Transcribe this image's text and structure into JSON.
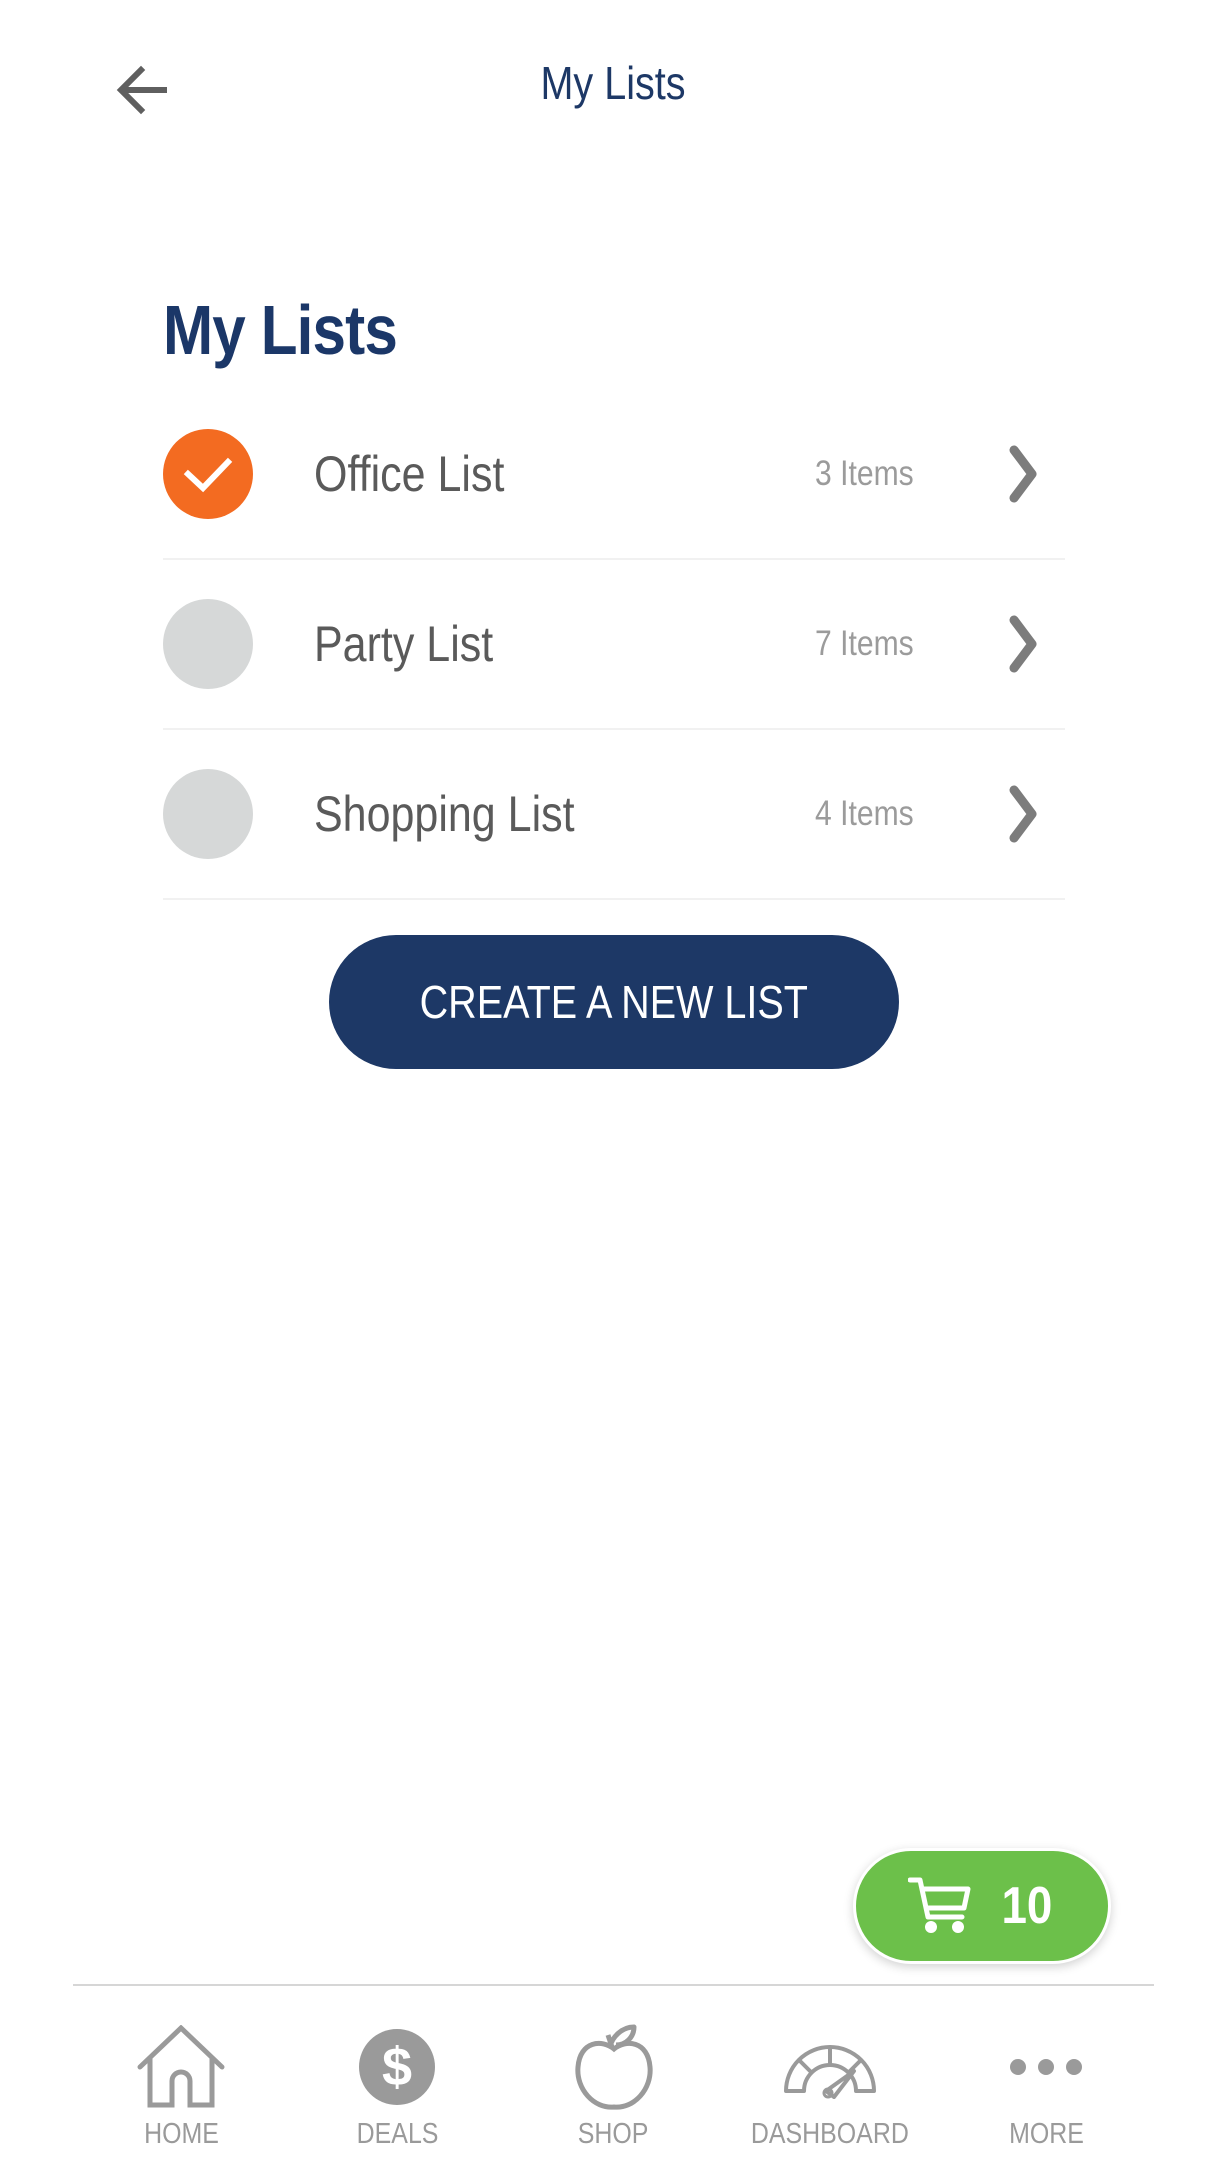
{
  "header": {
    "title": "My Lists",
    "back_icon": "arrow-left-icon"
  },
  "section": {
    "title": "My Lists"
  },
  "lists": [
    {
      "name": "Office List",
      "count": "3 Items",
      "selected": true
    },
    {
      "name": "Party List",
      "count": "7 Items",
      "selected": false
    },
    {
      "name": "Shopping List",
      "count": "4 Items",
      "selected": false
    }
  ],
  "create_button": {
    "label": "CREATE A NEW LIST"
  },
  "cart": {
    "count": "10",
    "icon": "shopping-cart-icon"
  },
  "nav": {
    "items": [
      {
        "label": "HOME",
        "icon": "home-icon"
      },
      {
        "label": "DEALS",
        "icon": "dollar-circle-icon"
      },
      {
        "label": "SHOP",
        "icon": "apple-icon"
      },
      {
        "label": "DASHBOARD",
        "icon": "speedometer-icon"
      },
      {
        "label": "MORE",
        "icon": "more-dots-icon"
      }
    ]
  },
  "colors": {
    "brand_navy": "#1d3866",
    "selected_orange": "#f36b21",
    "unselected_gray": "#d6d8d8",
    "cart_green": "#6cc04a",
    "nav_gray": "#9a9a9a"
  }
}
